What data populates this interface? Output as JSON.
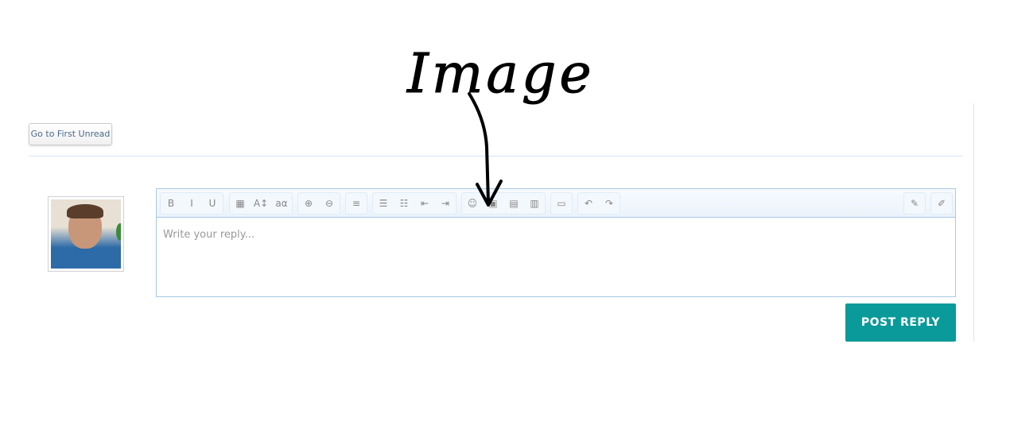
{
  "first_unread": "Go to First Unread",
  "editor": {
    "placeholder": "Write your reply...",
    "toolbar": [
      [
        {
          "icon": "bold-icon",
          "glyph": "B"
        },
        {
          "icon": "italic-icon",
          "glyph": "I"
        },
        {
          "icon": "underline-icon",
          "glyph": "U"
        }
      ],
      [
        {
          "icon": "text-color-icon",
          "glyph": "▦"
        },
        {
          "icon": "font-size-icon",
          "glyph": "A↕"
        },
        {
          "icon": "font-family-icon",
          "glyph": "aα"
        }
      ],
      [
        {
          "icon": "link-icon",
          "glyph": "⊕"
        },
        {
          "icon": "unlink-icon",
          "glyph": "⊖"
        }
      ],
      [
        {
          "icon": "align-icon",
          "glyph": "≡"
        }
      ],
      [
        {
          "icon": "bulleted-list-icon",
          "glyph": "☰"
        },
        {
          "icon": "numbered-list-icon",
          "glyph": "☷"
        },
        {
          "icon": "outdent-icon",
          "glyph": "⇤"
        },
        {
          "icon": "indent-icon",
          "glyph": "⇥"
        }
      ],
      [
        {
          "icon": "smilie-icon",
          "glyph": "☺"
        },
        {
          "icon": "image-icon",
          "glyph": "▣"
        },
        {
          "icon": "media-icon",
          "glyph": "▤"
        },
        {
          "icon": "insert-icon",
          "glyph": "▥"
        }
      ],
      [
        {
          "icon": "save-draft-icon",
          "glyph": "▭"
        }
      ],
      [
        {
          "icon": "undo-icon",
          "glyph": "↶"
        },
        {
          "icon": "redo-icon",
          "glyph": "↷"
        }
      ]
    ],
    "right": [
      {
        "icon": "remove-formatting-icon",
        "glyph": "✎"
      },
      {
        "icon": "toggle-source-icon",
        "glyph": "✐"
      }
    ]
  },
  "post_reply": "POST REPLY",
  "annotation": "Image"
}
